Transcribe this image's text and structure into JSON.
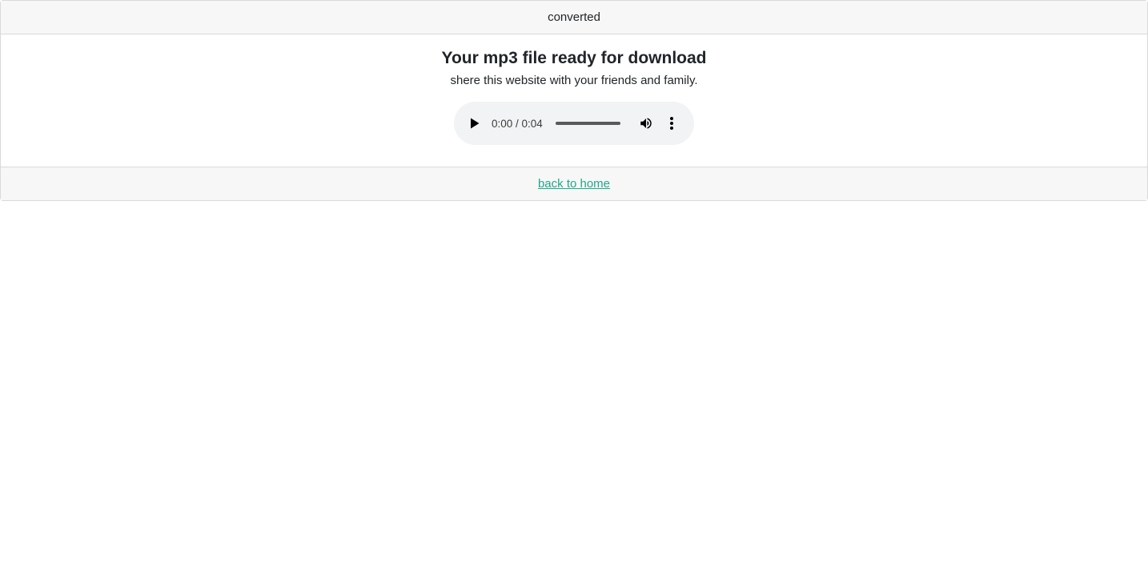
{
  "header": {
    "text": "converted"
  },
  "main": {
    "title": "Your mp3 file ready for download",
    "subtitle": "shere this website with your friends and family."
  },
  "audio_player": {
    "time_display": "0:00 / 0:04",
    "progress": 0,
    "play_icon": "play-icon",
    "volume_icon": "volume-icon",
    "menu_icon": "more-vertical-icon"
  },
  "footer": {
    "link_text": "back to home"
  },
  "colors": {
    "link": "#20a88a",
    "header_bg": "#f7f7f7",
    "player_bg": "#f1f3f4"
  }
}
